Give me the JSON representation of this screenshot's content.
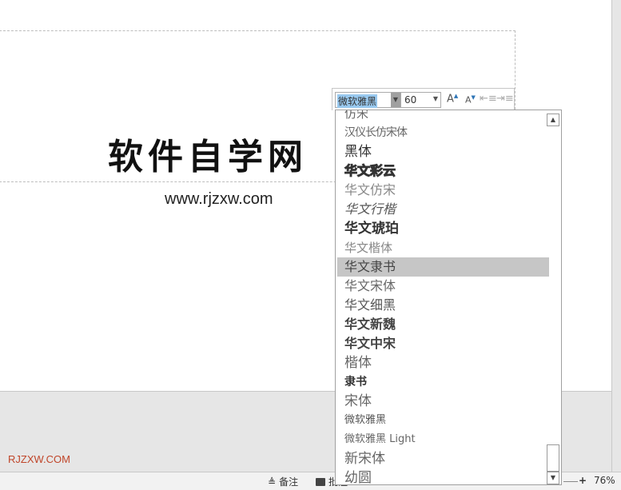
{
  "slide": {
    "title": "软件自学网",
    "subtitle": "www.rjzxw.com"
  },
  "watermark": "RJZXW.COM",
  "status": {
    "notes": "备注",
    "comments": "批注",
    "zoom": "76%",
    "zoom_in": "+"
  },
  "mini_toolbar": {
    "font": "微软雅黑",
    "size": "60",
    "grow": "A",
    "shrink": "A"
  },
  "font_list": {
    "items": [
      "仿宋",
      "汉仪长仿宋体",
      "黑体",
      "华文彩云",
      "华文仿宋",
      "华文行楷",
      "华文琥珀",
      "华文楷体",
      "华文隶书",
      "华文宋体",
      "华文细黑",
      "华文新魏",
      "华文中宋",
      "楷体",
      "隶书",
      "宋体",
      "微软雅黑",
      "微软雅黑 Light",
      "新宋体",
      "幼圆"
    ],
    "selected": "华文隶书"
  }
}
